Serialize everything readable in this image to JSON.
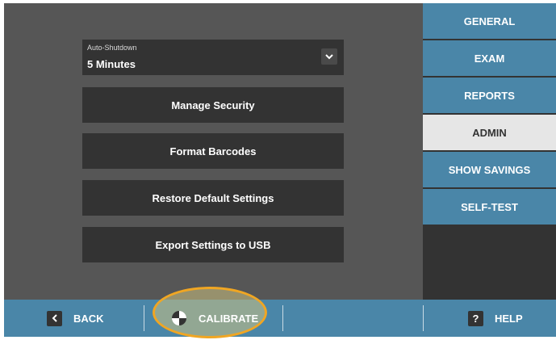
{
  "settings": {
    "auto_shutdown_label": "Auto-Shutdown",
    "auto_shutdown_value": "5 Minutes",
    "buttons": [
      "Manage Security",
      "Format Barcodes",
      "Restore Default Settings",
      "Export Settings to USB"
    ]
  },
  "tabs": [
    {
      "label": "GENERAL",
      "active": false
    },
    {
      "label": "EXAM",
      "active": false
    },
    {
      "label": "REPORTS",
      "active": false
    },
    {
      "label": "ADMIN",
      "active": true
    },
    {
      "label": "SHOW SAVINGS",
      "active": false
    },
    {
      "label": "SELF-TEST",
      "active": false
    }
  ],
  "bottombar": {
    "back_label": "BACK",
    "calibrate_label": "CALIBRATE",
    "help_label": "HELP",
    "help_icon_glyph": "?",
    "back_icon": "chevron-left-icon",
    "calibrate_icon": "calibration-target-icon",
    "help_icon": "question-icon"
  },
  "colors": {
    "accent": "#4a86a8",
    "highlight_ring": "#f0a623",
    "panel": "#333333",
    "background": "#565656"
  }
}
